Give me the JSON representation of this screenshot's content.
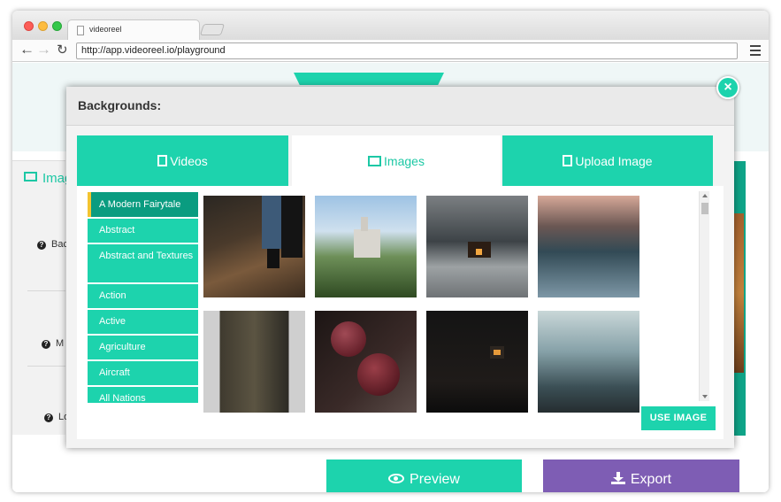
{
  "browser": {
    "tab_title": "videoreel",
    "url": "http://app.videoreel.io/playground"
  },
  "page": {
    "side_title": "Imag",
    "help_rows": [
      "Bac",
      "M",
      "Lo"
    ],
    "preview_label": "Preview",
    "export_label": "Export"
  },
  "modal": {
    "title": "Backgrounds:",
    "close_glyph": "×",
    "tabs": [
      {
        "label": "Videos",
        "icon": "file-video-icon"
      },
      {
        "label": "Images",
        "icon": "image-icon"
      },
      {
        "label": "Upload Image",
        "icon": "file-image-icon"
      }
    ],
    "active_tab": "Images",
    "categories": [
      "A Modern Fairytale",
      "Abstract",
      "Abstract and Textures",
      "Action",
      "Active",
      "Agriculture",
      "Aircraft",
      "All Nations"
    ],
    "selected_category": "A Modern Fairytale",
    "use_image_label": "USE IMAGE"
  },
  "colors": {
    "accent": "#1dd3ad",
    "accent_dark": "#0a9c80",
    "export": "#7e5db4",
    "highlight": "#f4c430"
  }
}
